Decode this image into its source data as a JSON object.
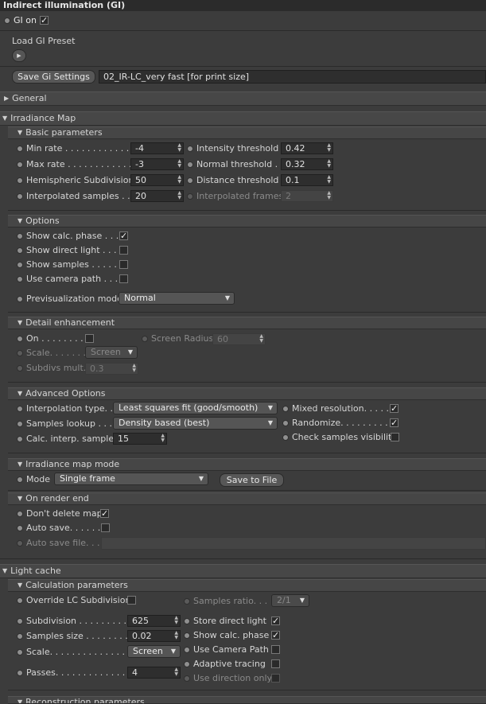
{
  "window_title": "Indirect illumination (GI)",
  "gi_on": {
    "label": "GI on"
  },
  "preset": {
    "label": "Load GI Preset"
  },
  "save": {
    "button_label": "Save Gi Settings",
    "file": "02_IR-LC_very fast [for print size]"
  },
  "general": {
    "label": "General"
  },
  "irradiance_map": {
    "label": "Irradiance Map",
    "basic": {
      "label": "Basic parameters",
      "min_rate": {
        "label": "Min rate . . . . . . . . . . . . . .",
        "value": "-4"
      },
      "max_rate": {
        "label": "Max rate . . . . . . . . . . . . . .",
        "value": "-3"
      },
      "hemispheric": {
        "label": "Hemispheric Subdivision",
        "value": "50"
      },
      "interp_samples": {
        "label": "Interpolated samples . . .",
        "value": "20"
      },
      "intensity": {
        "label": "Intensity threshold",
        "value": "0.42"
      },
      "normal": {
        "label": "Normal threshold . .",
        "value": "0.32"
      },
      "distance": {
        "label": "Distance threshold",
        "value": "0.1"
      },
      "interp_frames": {
        "label": "Interpolated frames",
        "value": "2"
      }
    },
    "options": {
      "label": "Options",
      "show_calc": "Show calc. phase . . .",
      "show_direct": "Show direct light . . .",
      "show_samples": "Show samples . . . . . .",
      "use_camera": "Use camera path . . . .",
      "previs_label": "Previsualization mode",
      "previs_value": "Normal"
    },
    "detail": {
      "label": "Detail enhancement",
      "on": "On . . . . . . . . .",
      "screen_radius_label": "Screen Radius",
      "screen_radius_value": "60",
      "scale_label": "Scale. . . . . . . . . .",
      "scale_value": "Screen",
      "subdivs_label": "Subdivs mult.",
      "subdivs_value": "0.3"
    },
    "advanced": {
      "label": "Advanced Options",
      "interp_type_label": "Interpolation type. .",
      "interp_type_value": "Least squares fit (good/smooth)",
      "lookup_label": "Samples lookup . . .",
      "lookup_value": "Density based (best)",
      "calc_interp_label": "Calc. interp. samples",
      "calc_interp_value": "15",
      "mixed": "Mixed resolution. . . . . .",
      "randomize": "Randomize. . . . . . . . . . .",
      "check_vis": "Check samples visibility"
    },
    "mode": {
      "label": "Irradiance map mode",
      "mode_label": "Mode",
      "mode_value": "Single frame",
      "save_to_file": "Save to File"
    },
    "render_end": {
      "label": "On render end",
      "dont_delete": "Don't delete map",
      "auto_save": "Auto save. . . . . . .",
      "auto_save_file": "Auto save file. . . ."
    }
  },
  "light_cache": {
    "label": "Light cache",
    "calc": {
      "label": "Calculation parameters",
      "override": "Override LC Subdivision",
      "samples_ratio_label": "Samples ratio. . .",
      "samples_ratio_value": "2/1",
      "subdivision_label": "Subdivision . . . . . . . . . . .",
      "subdivision_value": "625",
      "samples_size_label": "Samples size . . . . . . . . .",
      "samples_size_value": "0.02",
      "scale_label": "Scale. . . . . . . . . . . . . . . .",
      "scale_value": "Screen",
      "passes_label": "Passes. . . . . . . . . . . . . . .",
      "passes_value": "4",
      "store_direct": "Store direct light",
      "show_calc": "Show calc. phase",
      "use_camera": "Use Camera Path",
      "adaptive": "Adaptive tracing",
      "use_direction": "Use direction only"
    },
    "reconstruction": {
      "label": "Reconstruction parameters"
    }
  }
}
